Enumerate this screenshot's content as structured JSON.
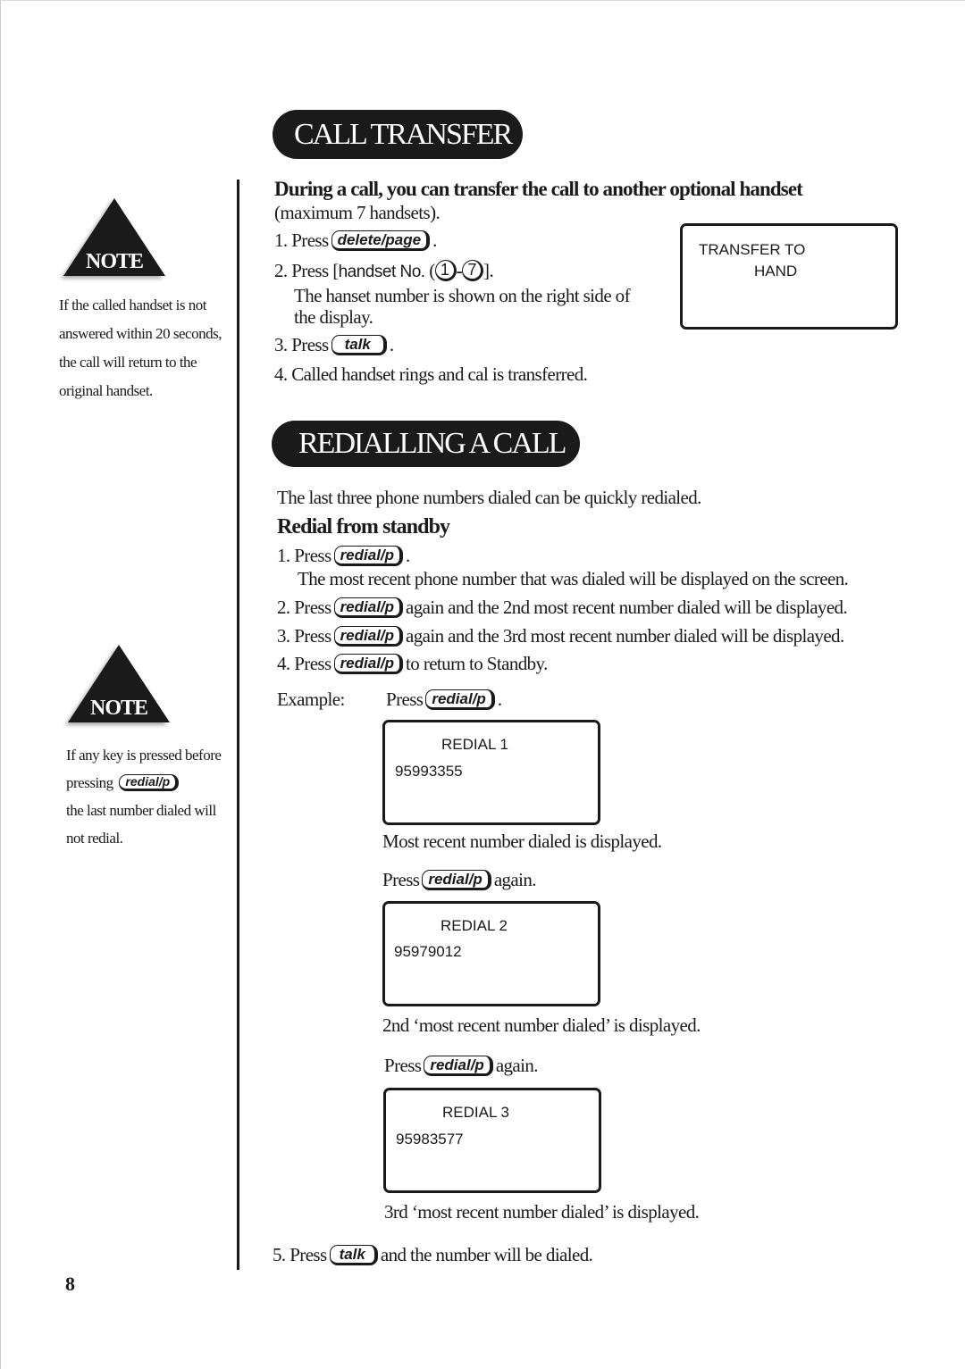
{
  "call_transfer": {
    "title": "CALL TRANSFER",
    "intro_bold": "During a call, you can transfer the call to another optional handset",
    "intro_sub": "(maximum 7 handsets).",
    "press": "Press",
    "steps": [
      {
        "num": "1.",
        "key": "delete/page",
        "after": "."
      },
      {
        "num": "2.",
        "bracket_text": "handset No.",
        "range_start": "1",
        "range_end": "7",
        "after": "."
      },
      {
        "num": "3.",
        "key": "talk",
        "after": "."
      },
      {
        "num": "4.",
        "text": "Called handset rings and cal is transferred."
      }
    ],
    "step2_desc_1": "The hanset number is shown on the right side of",
    "step2_desc_2": "the display.",
    "display": {
      "line1": "TRANSFER TO",
      "line2": "HAND"
    }
  },
  "note1": {
    "label": "NOTE",
    "lines": [
      "If the called handset is not",
      "answered within 20 seconds,",
      "the call will return to the",
      "original handset."
    ]
  },
  "redial": {
    "title": "REDIALLING A CALL",
    "intro": "The last three phone numbers dialed can be quickly redialed.",
    "subheading": "Redial from standby",
    "press": "Press",
    "key": "redial/p",
    "steps": [
      {
        "num": "1.",
        "after": "."
      },
      {
        "num": "2.",
        "after": "again and the 2nd most recent number dialed will be displayed."
      },
      {
        "num": "3.",
        "after": "again and the 3rd most recent number dialed will be displayed."
      },
      {
        "num": "4.",
        "after": "to return to Standby."
      }
    ],
    "step1_desc": "The most recent phone number that was dialed will be displayed on the screen.",
    "example_label": "Example:",
    "again": "again.",
    "displays": [
      {
        "title": "REDIAL 1",
        "number": "95993355",
        "caption": "Most recent number dialed is displayed."
      },
      {
        "title": "REDIAL 2",
        "number": "95979012",
        "caption": "2nd ‘most recent number dialed’ is displayed."
      },
      {
        "title": "REDIAL 3",
        "number": "95983577",
        "caption": "3rd ‘most recent number dialed’ is displayed."
      }
    ],
    "step5": {
      "num": "5.",
      "key": "talk",
      "after": "and the number will be dialed."
    }
  },
  "note2": {
    "label": "NOTE",
    "line1": "If any key is pressed before",
    "line2": "pressing",
    "key": "redial/p",
    "line3": "the last number dialed will",
    "line4": "not redial."
  },
  "page_number": "8"
}
